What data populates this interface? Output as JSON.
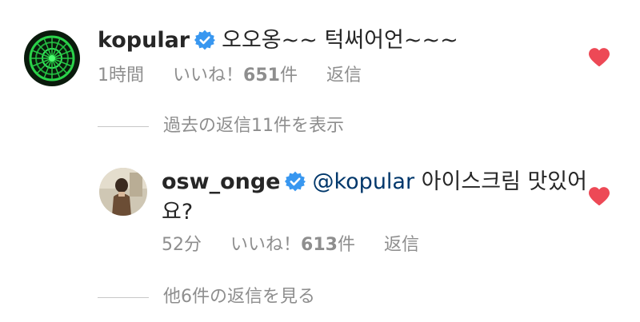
{
  "comment1": {
    "username": "kopular",
    "text": "오오옹~~ 턱써어언~~~",
    "time": "1時間",
    "likes_prefix": "いいね！",
    "likes_count": "651",
    "likes_suffix": "件",
    "reply_label": "返信",
    "liked": true
  },
  "view_past_replies": "過去の返信11件を表示",
  "comment2": {
    "username": "osw_onge",
    "mention": "@kopular",
    "text_line1": "아이스크림 맛있어",
    "text_line2": "요?",
    "time": "52分",
    "likes_prefix": "いいね！",
    "likes_count": "613",
    "likes_suffix": "件",
    "reply_label": "返信",
    "liked": true
  },
  "view_more_replies": "他6件の返信を見る",
  "colors": {
    "heart": "#ed4956",
    "verified": "#3897f0",
    "mention": "#00376b",
    "secondary_text": "#8e8e8e"
  }
}
